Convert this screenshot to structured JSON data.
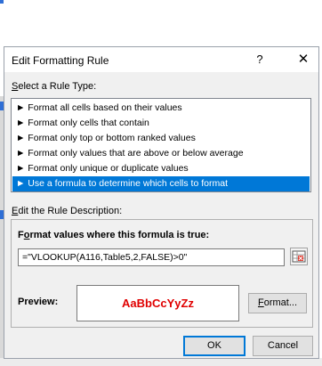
{
  "dialog": {
    "title": "Edit Formatting Rule",
    "help_icon_glyph": "?",
    "close_icon_glyph": "✕"
  },
  "rule_type": {
    "label_accel": "S",
    "label_rest": "elect a Rule Type:",
    "items": [
      {
        "label": "► Format all cells based on their values",
        "selected": false
      },
      {
        "label": "► Format only cells that contain",
        "selected": false
      },
      {
        "label": "► Format only top or bottom ranked values",
        "selected": false
      },
      {
        "label": "► Format only values that are above or below average",
        "selected": false
      },
      {
        "label": "► Format only unique or duplicate values",
        "selected": false
      },
      {
        "label": "► Use a formula to determine which cells to format",
        "selected": true
      }
    ]
  },
  "description": {
    "label_accel": "E",
    "label_rest": "dit the Rule Description:",
    "formula_label_pre": "F",
    "formula_label_accel": "o",
    "formula_label_rest": "rmat values where this formula is true:",
    "formula_value": "=\"VLOOKUP(A116,Table5,2,FALSE)>0\""
  },
  "preview": {
    "label": "Preview:",
    "sample_text": "AaBbCcYyZz",
    "sample_color": "#e00000"
  },
  "buttons": {
    "format_accel": "F",
    "format_rest": "ormat...",
    "ok": "OK",
    "cancel": "Cancel"
  },
  "colors": {
    "selection": "#0078d7",
    "dialog_bg": "#f0f0f0"
  }
}
